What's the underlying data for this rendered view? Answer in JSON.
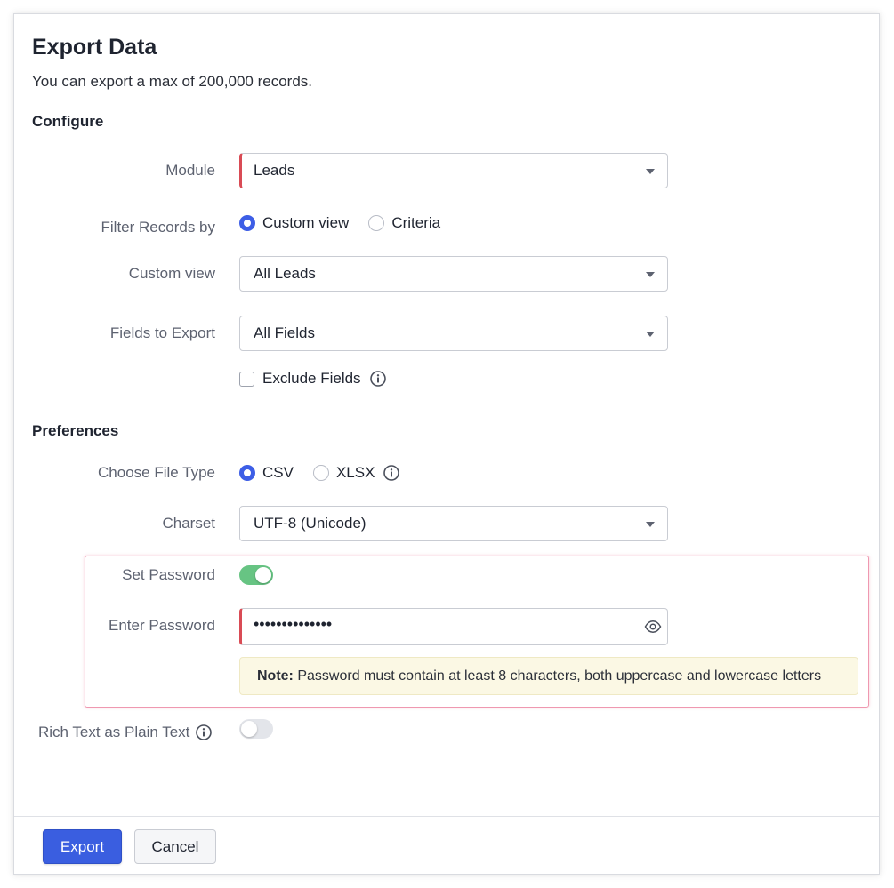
{
  "dialog": {
    "title": "Export Data",
    "subtitle": "You can export a max of 200,000 records."
  },
  "configure": {
    "heading": "Configure",
    "module": {
      "label": "Module",
      "value": "Leads"
    },
    "filter": {
      "label": "Filter Records by",
      "options": [
        {
          "label": "Custom view",
          "checked": true
        },
        {
          "label": "Criteria",
          "checked": false
        }
      ]
    },
    "custom_view": {
      "label": "Custom view",
      "value": "All Leads"
    },
    "fields": {
      "label": "Fields to Export",
      "value": "All Fields"
    },
    "exclude_fields": {
      "label": "Exclude Fields",
      "checked": false,
      "icon": "info-icon"
    }
  },
  "preferences": {
    "heading": "Preferences",
    "file_type": {
      "label": "Choose File Type",
      "options": [
        {
          "label": "CSV",
          "checked": true
        },
        {
          "label": "XLSX",
          "checked": false
        }
      ],
      "icon": "info-icon"
    },
    "charset": {
      "label": "Charset",
      "value": "UTF-8 (Unicode)"
    },
    "set_password": {
      "label": "Set Password",
      "enabled": true
    },
    "enter_password": {
      "label": "Enter Password",
      "value": "••••••••••••••",
      "icon": "eye-icon"
    },
    "note": {
      "prefix": "Note:",
      "text": " Password must contain at least 8 characters, both uppercase and lowercase letters"
    },
    "rich_text": {
      "label": "Rich Text as Plain Text",
      "enabled": false,
      "icon": "info-icon"
    }
  },
  "footer": {
    "export_label": "Export",
    "cancel_label": "Cancel"
  },
  "colors": {
    "primary": "#3a5ee0",
    "required": "#d94b55",
    "toggle_on": "#67c483",
    "highlight_border": "#ef98b0",
    "note_bg": "#fbf8e4"
  }
}
